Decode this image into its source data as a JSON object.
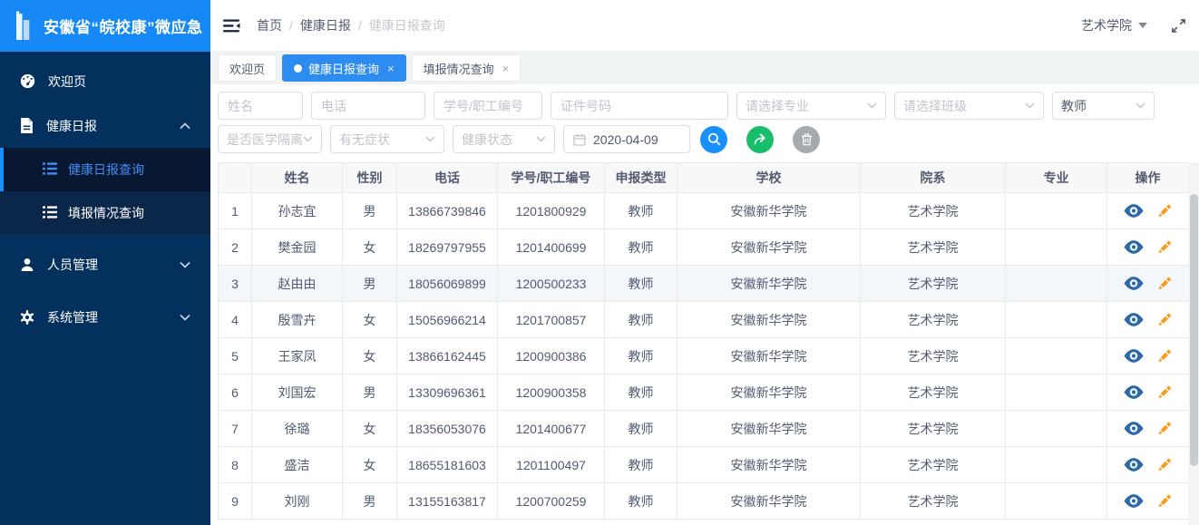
{
  "app": {
    "title": "安徽省“皖校康”微应急"
  },
  "header": {
    "breadcrumb": {
      "home": "首页",
      "section": "健康日报",
      "current": "健康日报查询",
      "separator": "/"
    },
    "org_selector": {
      "value": "艺术学院",
      "icon": "caret-down-icon"
    },
    "fullscreen_icon": "fullscreen-expand-icon",
    "collapse_icon": "menu-fold-icon"
  },
  "sidebar": {
    "items": [
      {
        "label": "欢迎页",
        "icon": "dashboard-icon"
      },
      {
        "label": "健康日报",
        "icon": "document-icon",
        "expanded": true
      },
      {
        "label": "人员管理",
        "icon": "user-icon",
        "expanded": false
      },
      {
        "label": "系统管理",
        "icon": "gear-icon",
        "expanded": false
      }
    ],
    "submenu": [
      {
        "label": "健康日报查询",
        "icon": "list-icon",
        "active": true
      },
      {
        "label": "填报情况查询",
        "icon": "list-icon",
        "active": false
      }
    ]
  },
  "tabs": [
    {
      "label": "欢迎页",
      "active": false,
      "closable": false
    },
    {
      "label": "健康日报查询",
      "active": true,
      "closable": true,
      "close_glyph": "×"
    },
    {
      "label": "填报情况查询",
      "active": false,
      "closable": true,
      "close_glyph": "×"
    }
  ],
  "filters": {
    "name_placeholder": "姓名",
    "phone_placeholder": "电话",
    "staff_no_placeholder": "学号/职工编号",
    "id_card_placeholder": "证件号码",
    "major_placeholder": "请选择专业",
    "class_placeholder": "请选择班级",
    "person_type_value": "教师",
    "isolation_placeholder": "是否医学隔离",
    "symptom_placeholder": "有无症状",
    "health_state_placeholder": "健康状态",
    "date_value": "2020-04-09",
    "buttons": [
      {
        "name": "search",
        "icon": "search-icon",
        "color": "#1890ff"
      },
      {
        "name": "export",
        "icon": "export-icon",
        "color": "#19be6b"
      },
      {
        "name": "delete",
        "icon": "trash-icon",
        "color": "#a6a9ad"
      }
    ]
  },
  "table": {
    "columns": [
      "",
      "姓名",
      "性别",
      "电话",
      "学号/职工编号",
      "申报类型",
      "学校",
      "院系",
      "专业",
      "操作"
    ],
    "rows": [
      {
        "index": 1,
        "name": "孙志宜",
        "gender": "男",
        "phone": "13866739846",
        "code": "1201800929",
        "type": "教师",
        "school": "安徽新华学院",
        "department": "艺术学院",
        "major": "",
        "highlighted": false
      },
      {
        "index": 2,
        "name": "樊金园",
        "gender": "女",
        "phone": "18269797955",
        "code": "1201400699",
        "type": "教师",
        "school": "安徽新华学院",
        "department": "艺术学院",
        "major": "",
        "highlighted": false
      },
      {
        "index": 3,
        "name": "赵由由",
        "gender": "男",
        "phone": "18056069899",
        "code": "1200500233",
        "type": "教师",
        "school": "安徽新华学院",
        "department": "艺术学院",
        "major": "",
        "highlighted": true
      },
      {
        "index": 4,
        "name": "殷雪卉",
        "gender": "女",
        "phone": "15056966214",
        "code": "1201700857",
        "type": "教师",
        "school": "安徽新华学院",
        "department": "艺术学院",
        "major": "",
        "highlighted": false
      },
      {
        "index": 5,
        "name": "王家凤",
        "gender": "女",
        "phone": "13866162445",
        "code": "1200900386",
        "type": "教师",
        "school": "安徽新华学院",
        "department": "艺术学院",
        "major": "",
        "highlighted": false
      },
      {
        "index": 6,
        "name": "刘国宏",
        "gender": "男",
        "phone": "13309696361",
        "code": "1200900358",
        "type": "教师",
        "school": "安徽新华学院",
        "department": "艺术学院",
        "major": "",
        "highlighted": false
      },
      {
        "index": 7,
        "name": "徐璐",
        "gender": "女",
        "phone": "18356053076",
        "code": "1201400677",
        "type": "教师",
        "school": "安徽新华学院",
        "department": "艺术学院",
        "major": "",
        "highlighted": false
      },
      {
        "index": 8,
        "name": "盛洁",
        "gender": "女",
        "phone": "18655181603",
        "code": "1201100497",
        "type": "教师",
        "school": "安徽新华学院",
        "department": "艺术学院",
        "major": "",
        "highlighted": false
      },
      {
        "index": 9,
        "name": "刘刚",
        "gender": "男",
        "phone": "13155163817",
        "code": "1200700259",
        "type": "教师",
        "school": "安徽新华学院",
        "department": "艺术学院",
        "major": "",
        "highlighted": false
      }
    ],
    "row_action_icons": [
      "view-eye-icon",
      "edit-pencil-icon"
    ]
  },
  "colors": {
    "accent": "#2d8cf0",
    "logo_bar": "#1689f7",
    "sidebar_bg": "#04305e",
    "active_submenu_bg": "#081830",
    "table_header_bg": "#f8f8f9",
    "border": "#e8eaec",
    "view_icon": "#2d69a8",
    "edit_icon": "#fb9b1f",
    "export_btn": "#19be6b",
    "delete_btn": "#a6a9ad"
  }
}
